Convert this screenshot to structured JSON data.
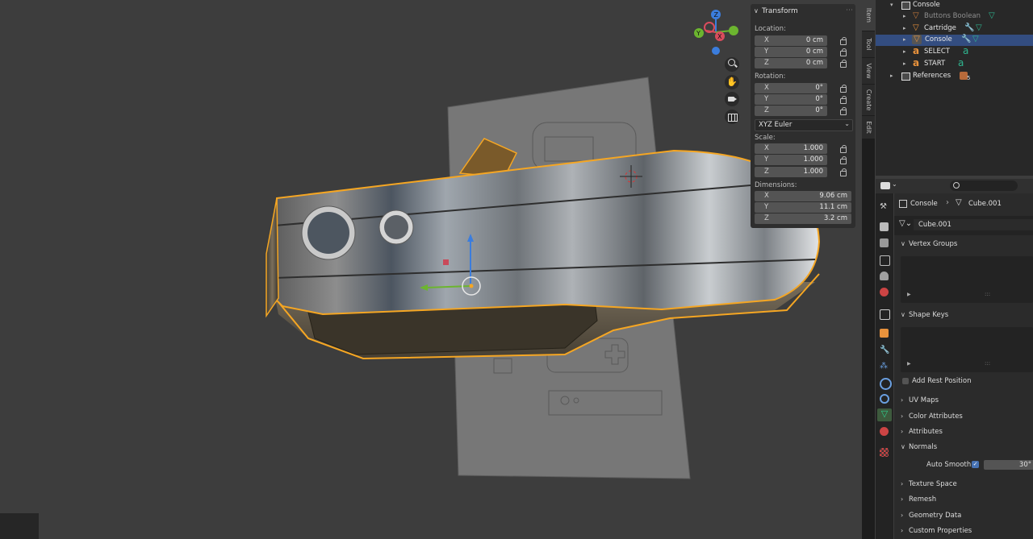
{
  "npanel": {
    "title": "Transform",
    "location_label": "Location:",
    "location": [
      {
        "axis": "X",
        "value": "0 cm"
      },
      {
        "axis": "Y",
        "value": "0 cm"
      },
      {
        "axis": "Z",
        "value": "0 cm"
      }
    ],
    "rotation_label": "Rotation:",
    "rotation": [
      {
        "axis": "X",
        "value": "0°"
      },
      {
        "axis": "Y",
        "value": "0°"
      },
      {
        "axis": "Z",
        "value": "0°"
      }
    ],
    "rotation_mode": "XYZ Euler",
    "scale_label": "Scale:",
    "scale": [
      {
        "axis": "X",
        "value": "1.000"
      },
      {
        "axis": "Y",
        "value": "1.000"
      },
      {
        "axis": "Z",
        "value": "1.000"
      }
    ],
    "dimensions_label": "Dimensions:",
    "dimensions": [
      {
        "axis": "X",
        "value": "9.06 cm"
      },
      {
        "axis": "Y",
        "value": "11.1 cm"
      },
      {
        "axis": "Z",
        "value": "3.2 cm"
      }
    ]
  },
  "gizmo": {
    "x": "X",
    "y": "Y",
    "z": "Z"
  },
  "tabs": [
    "Item",
    "Tool",
    "View",
    "Create",
    "Edit"
  ],
  "outliner": {
    "items": [
      {
        "name": "Console",
        "icon": "collection-icon"
      },
      {
        "name": "Buttons Boolean",
        "icon": "mesh-icon"
      },
      {
        "name": "Cartridge",
        "icon": "mesh-icon"
      },
      {
        "name": "Console",
        "icon": "mesh-icon"
      },
      {
        "name": "SELECT",
        "icon": "text-icon"
      },
      {
        "name": "START",
        "icon": "text-icon"
      },
      {
        "name": "References",
        "icon": "collection-icon"
      }
    ],
    "references_count": "5"
  },
  "properties": {
    "breadcrumb_object": "Console",
    "breadcrumb_mesh": "Cube.001",
    "mesh_name": "Cube.001",
    "panels": {
      "vertex_groups": "Vertex Groups",
      "shape_keys": "Shape Keys",
      "add_rest_position": "Add Rest Position",
      "uv_maps": "UV Maps",
      "color_attributes": "Color Attributes",
      "attributes": "Attributes",
      "normals": "Normals",
      "auto_smooth": "Auto Smooth",
      "auto_smooth_angle": "30°",
      "texture_space": "Texture Space",
      "remesh": "Remesh",
      "geometry_data": "Geometry Data",
      "custom_properties": "Custom Properties"
    }
  },
  "colors": {
    "accent": "#4772b3",
    "selection_outline": "#f5a623",
    "selected_row": "#334d80"
  }
}
